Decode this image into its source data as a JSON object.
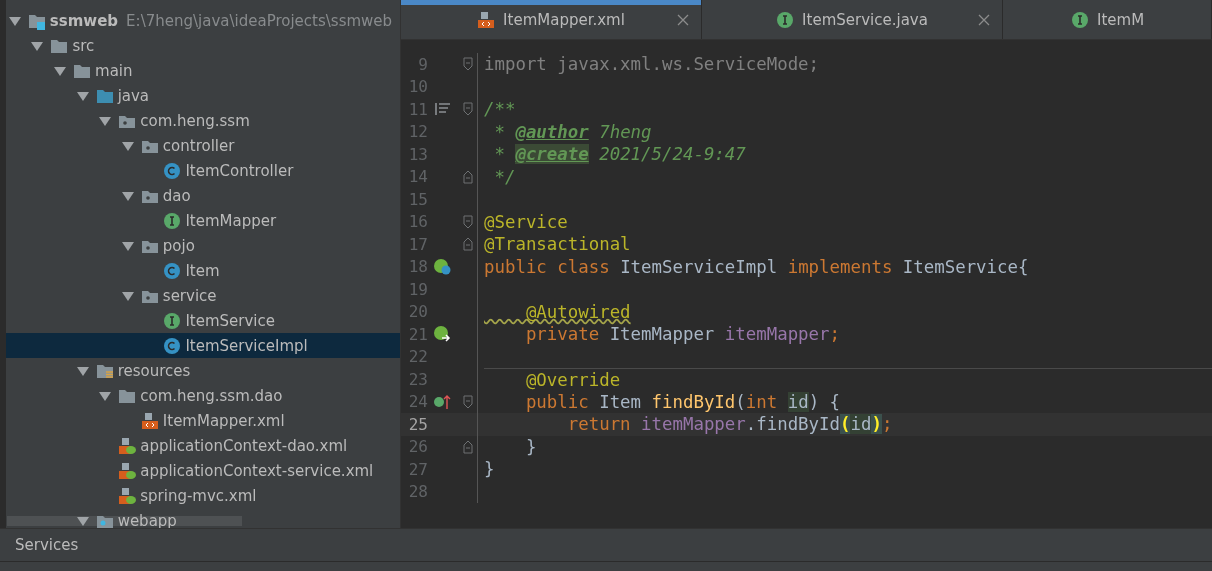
{
  "project_tree": {
    "items": [
      {
        "label": "ssmweb",
        "path": "E:\\7heng\\java\\ideaProjects\\ssmweb",
        "kind": "module",
        "expanded": true,
        "selected": false,
        "children": [
          {
            "label": "src",
            "kind": "folder",
            "expanded": true,
            "selected": false,
            "children": [
              {
                "label": "main",
                "kind": "folder",
                "expanded": true,
                "selected": false,
                "children": [
                  {
                    "label": "java",
                    "kind": "source-root",
                    "expanded": true,
                    "selected": false,
                    "children": [
                      {
                        "label": "com.heng.ssm",
                        "kind": "package",
                        "expanded": true,
                        "selected": false,
                        "children": [
                          {
                            "label": "controller",
                            "kind": "package",
                            "expanded": true,
                            "selected": false,
                            "children": [
                              {
                                "label": "ItemController",
                                "kind": "class",
                                "selected": false
                              }
                            ]
                          },
                          {
                            "label": "dao",
                            "kind": "package",
                            "expanded": true,
                            "selected": false,
                            "children": [
                              {
                                "label": "ItemMapper",
                                "kind": "interface",
                                "selected": false
                              }
                            ]
                          },
                          {
                            "label": "pojo",
                            "kind": "package",
                            "expanded": true,
                            "selected": false,
                            "children": [
                              {
                                "label": "Item",
                                "kind": "class",
                                "selected": false
                              }
                            ]
                          },
                          {
                            "label": "service",
                            "kind": "package",
                            "expanded": true,
                            "selected": false,
                            "children": [
                              {
                                "label": "ItemService",
                                "kind": "interface",
                                "selected": false
                              },
                              {
                                "label": "ItemServiceImpl",
                                "kind": "class",
                                "selected": true
                              }
                            ]
                          }
                        ]
                      }
                    ]
                  },
                  {
                    "label": "resources",
                    "kind": "resources-root",
                    "expanded": true,
                    "selected": false,
                    "children": [
                      {
                        "label": "com.heng.ssm.dao",
                        "kind": "folder",
                        "expanded": true,
                        "selected": false,
                        "children": [
                          {
                            "label": "ItemMapper.xml",
                            "kind": "xml",
                            "selected": false
                          }
                        ]
                      },
                      {
                        "label": "applicationContext-dao.xml",
                        "kind": "spring-xml",
                        "selected": false
                      },
                      {
                        "label": "applicationContext-service.xml",
                        "kind": "spring-xml",
                        "selected": false
                      },
                      {
                        "label": "spring-mvc.xml",
                        "kind": "spring-xml",
                        "selected": false
                      }
                    ]
                  },
                  {
                    "label": "webapp",
                    "kind": "web-folder",
                    "expanded": true,
                    "selected": false
                  }
                ]
              }
            ]
          }
        ]
      }
    ]
  },
  "editor_tabs": [
    {
      "label": "ItemMapper.xml",
      "kind": "xml",
      "selected": true,
      "closable": true
    },
    {
      "label": "ItemService.java",
      "kind": "interface",
      "selected": false,
      "closable": true
    },
    {
      "label": "ItemM",
      "kind": "interface",
      "selected": false,
      "closable": false
    }
  ],
  "code_lines": [
    {
      "number": "9",
      "current": false,
      "separator": false,
      "fold_marker": {
        "kind": "open"
      },
      "tokens": [
        {
          "kind": "unused",
          "text": "import javax.xml.ws.ServiceMode;"
        }
      ]
    },
    {
      "number": "10",
      "current": false,
      "separator": false
    },
    {
      "number": "11",
      "current": false,
      "separator": false,
      "gutter_icon": {
        "kind": "rendered-doc"
      },
      "fold_marker": {
        "kind": "open"
      },
      "tokens": [
        {
          "kind": "comment",
          "text": "/**"
        }
      ]
    },
    {
      "number": "12",
      "current": false,
      "separator": false,
      "tokens": [
        {
          "kind": "comment",
          "text": " * "
        },
        {
          "kind": "doc-tag",
          "text": "@author"
        },
        {
          "kind": "comment",
          "text": " 7heng"
        }
      ]
    },
    {
      "number": "13",
      "current": false,
      "separator": false,
      "tokens": [
        {
          "kind": "comment",
          "text": " * "
        },
        {
          "kind": "doc-tag-marked",
          "text": "@create"
        },
        {
          "kind": "comment",
          "text": " 2021/5/24-9:47"
        }
      ]
    },
    {
      "number": "14",
      "current": false,
      "separator": false,
      "fold_marker": {
        "kind": "close"
      },
      "tokens": [
        {
          "kind": "comment",
          "text": " */"
        }
      ]
    },
    {
      "number": "15",
      "current": false,
      "separator": false
    },
    {
      "number": "16",
      "current": false,
      "separator": false,
      "fold_marker": {
        "kind": "open"
      },
      "tokens": [
        {
          "kind": "annotation",
          "text": "@Service"
        }
      ]
    },
    {
      "number": "17",
      "current": false,
      "separator": false,
      "fold_marker": {
        "kind": "close"
      },
      "tokens": [
        {
          "kind": "annotation",
          "text": "@Transactional"
        }
      ]
    },
    {
      "number": "18",
      "current": false,
      "separator": false,
      "gutter_icon": {
        "kind": "bean-class"
      },
      "tokens": [
        {
          "kind": "keyword",
          "text": "public class "
        },
        {
          "kind": "plain",
          "text": "ItemServiceImpl "
        },
        {
          "kind": "keyword",
          "text": "implements "
        },
        {
          "kind": "plain",
          "text": "ItemService{"
        }
      ]
    },
    {
      "number": "19",
      "current": false,
      "separator": false
    },
    {
      "number": "20",
      "current": false,
      "separator": false,
      "tokens": [
        {
          "kind": "annotation-warning",
          "text": "    @Autowired"
        }
      ]
    },
    {
      "number": "21",
      "current": false,
      "separator": false,
      "gutter_icon": {
        "kind": "bean-injection"
      },
      "tokens": [
        {
          "kind": "keyword",
          "text": "    private "
        },
        {
          "kind": "plain",
          "text": "ItemMapper "
        },
        {
          "kind": "field",
          "text": "itemMapper"
        },
        {
          "kind": "keyword",
          "text": ";"
        }
      ]
    },
    {
      "number": "22",
      "current": false,
      "separator": false
    },
    {
      "number": "23",
      "current": false,
      "separator": true,
      "tokens": [
        {
          "kind": "annotation",
          "text": "    @Override"
        }
      ]
    },
    {
      "number": "24",
      "current": false,
      "separator": false,
      "gutter_icon": {
        "kind": "implements-method"
      },
      "fold_marker": {
        "kind": "open"
      },
      "tokens": [
        {
          "kind": "keyword",
          "text": "    public "
        },
        {
          "kind": "plain",
          "text": "Item "
        },
        {
          "kind": "method",
          "text": "findById"
        },
        {
          "kind": "plain",
          "text": "("
        },
        {
          "kind": "keyword",
          "text": "int "
        },
        {
          "kind": "param",
          "text": "id"
        },
        {
          "kind": "plain",
          "text": ") {"
        }
      ]
    },
    {
      "number": "25",
      "current": true,
      "separator": false,
      "tokens": [
        {
          "kind": "keyword",
          "text": "        return "
        },
        {
          "kind": "field",
          "text": "itemMapper"
        },
        {
          "kind": "plain",
          "text": ".findById"
        },
        {
          "kind": "brace-match",
          "text": "("
        },
        {
          "kind": "param",
          "text": "id"
        },
        {
          "kind": "brace-match",
          "text": ")"
        },
        {
          "kind": "keyword",
          "text": ";"
        }
      ]
    },
    {
      "number": "26",
      "current": false,
      "separator": false,
      "fold_marker": {
        "kind": "close"
      },
      "tokens": [
        {
          "kind": "plain",
          "text": "    }"
        }
      ]
    },
    {
      "number": "27",
      "current": false,
      "separator": false,
      "tokens": [
        {
          "kind": "plain",
          "text": "}"
        }
      ]
    },
    {
      "number": "28",
      "current": false,
      "separator": false
    }
  ],
  "bottom_panel": {
    "title": "Services"
  }
}
